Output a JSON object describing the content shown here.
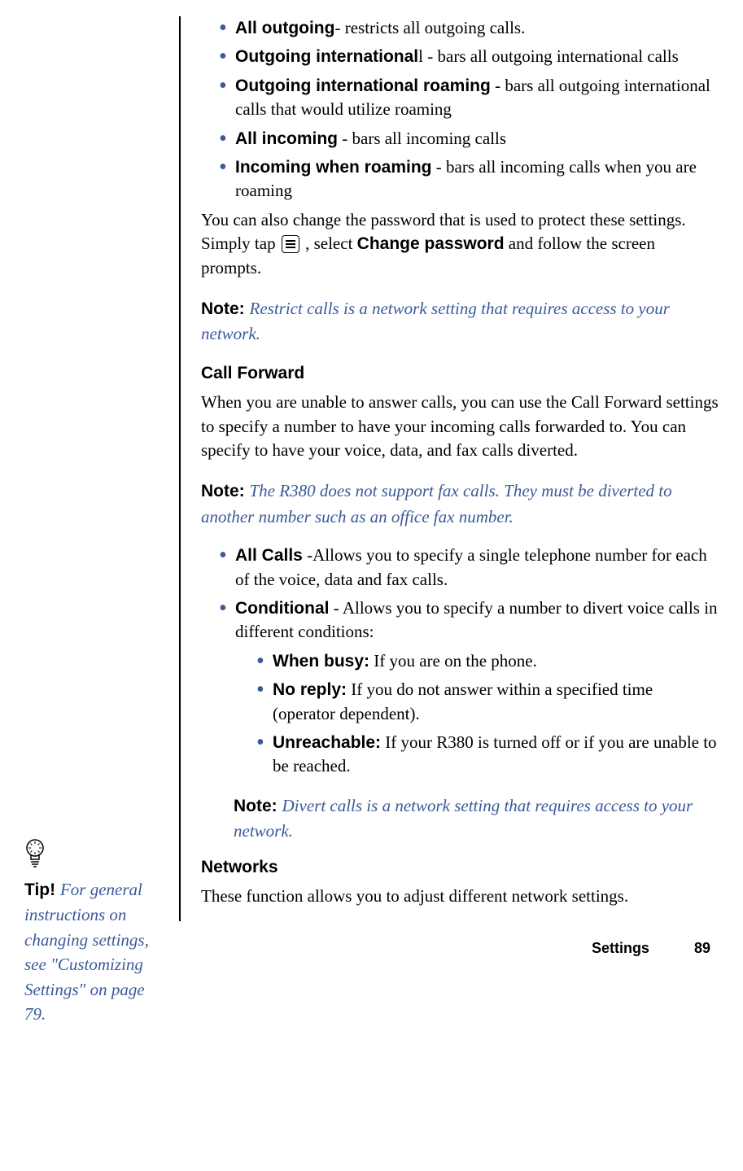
{
  "call_barring": {
    "items": [
      {
        "label": "All outgoing",
        "suffix": "-",
        "desc": " restricts all outgoing calls."
      },
      {
        "label": "Outgoing international",
        "suffix": " - ",
        "desc": "bars all outgoing international calls"
      },
      {
        "label": "Outgoing international roaming",
        "suffix": " - ",
        "desc": "bars all outgoing international calls that would utilize roaming"
      },
      {
        "label": "All incoming",
        "suffix": " - ",
        "desc": "bars all incoming calls"
      },
      {
        "label": "Incoming when roaming",
        "suffix": " - ",
        "desc": "bars all incoming calls when you are roaming"
      }
    ],
    "password_change": {
      "pre": "You can also change the password that is used to protect these settings. Simply tap ",
      "mid": " , select ",
      "bold": "Change password",
      "post": " and follow the screen prompts."
    },
    "note": {
      "label": "Note:  ",
      "text": "Restrict calls is a network setting that requires access to your network."
    }
  },
  "call_forward": {
    "heading": "Call Forward",
    "intro": "When you are unable to answer calls, you can use the Call Forward settings to specify a number to have your incoming calls forwarded to. You can specify to have your voice, data, and fax calls diverted.",
    "note": {
      "label": "Note:  ",
      "text": "The R380 does not support fax calls. They must be diverted to another number such as an office fax number."
    },
    "types": [
      {
        "label": "All Calls",
        "suffix": " -",
        "desc": "Allows you to specify a single telephone number for each of the voice, data and fax calls."
      },
      {
        "label": "Conditional",
        "suffix": " - ",
        "desc": "Allows you to specify a number to divert voice calls in different conditions:"
      }
    ],
    "conditions": [
      {
        "label": "When busy:",
        "desc": " If you are on the phone."
      },
      {
        "label": "No reply:",
        "desc": " If you do not answer within a specified time (operator dependent)."
      },
      {
        "label": "Unreachable:",
        "desc": " If your R380 is turned off or if you are unable to be reached."
      }
    ],
    "note2": {
      "label": "Note:  ",
      "text": "Divert calls is a network setting that requires access to your network."
    }
  },
  "networks": {
    "heading": "Networks",
    "intro": "These function allows you to adjust different network settings."
  },
  "tip": {
    "label": "Tip! ",
    "text": "For general instructions on changing settings, see \"Customizing Settings\" on page 79."
  },
  "footer": {
    "section": "Settings",
    "page": "89"
  }
}
